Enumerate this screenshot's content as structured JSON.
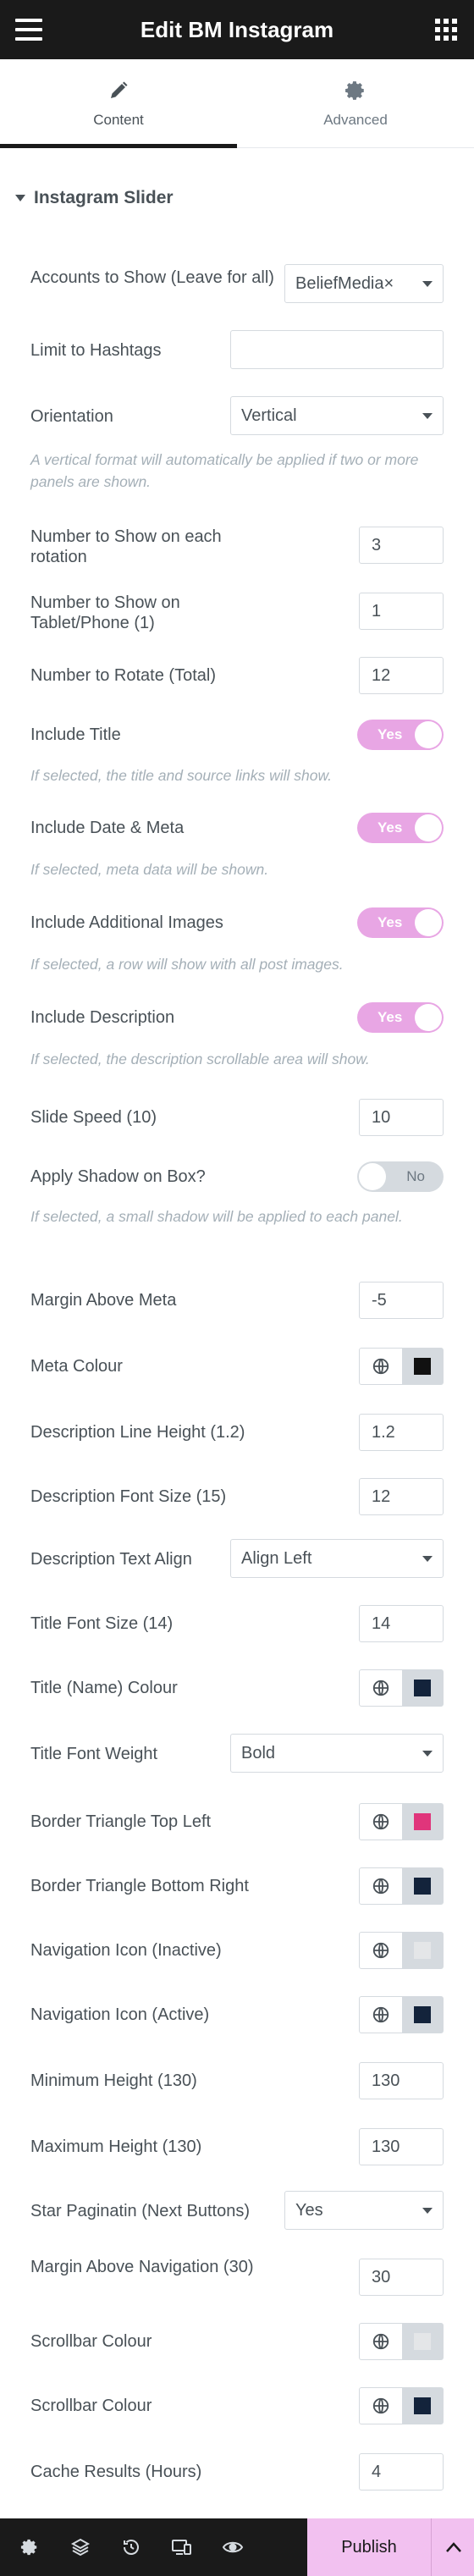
{
  "header": {
    "title": "Edit BM Instagram"
  },
  "tabs": {
    "content": "Content",
    "advanced": "Advanced"
  },
  "section": {
    "title": "Instagram Slider"
  },
  "fields": {
    "accounts": {
      "label": "Accounts to Show (Leave for all)",
      "value": "BeliefMedia×"
    },
    "hashtags": {
      "label": "Limit to Hashtags",
      "value": ""
    },
    "orientation": {
      "label": "Orientation",
      "value": "Vertical",
      "desc": "A vertical format will automatically be applied if two or more panels are shown."
    },
    "num_show": {
      "label": "Number to Show on each rotation",
      "value": "3"
    },
    "num_tablet": {
      "label": "Number to Show on Tablet/Phone (1)",
      "value": "1"
    },
    "num_rotate": {
      "label": "Number to Rotate (Total)",
      "value": "12"
    },
    "include_title": {
      "label": "Include Title",
      "state": "Yes",
      "desc": "If selected, the title and source links will show."
    },
    "include_date": {
      "label": "Include Date & Meta",
      "state": "Yes",
      "desc": "If selected, meta data will be shown."
    },
    "include_images": {
      "label": "Include Additional Images",
      "state": "Yes",
      "desc": "If selected, a row will show with all post images."
    },
    "include_desc": {
      "label": "Include Description",
      "state": "Yes",
      "desc": "If selected, the description scrollable area will show."
    },
    "slide_speed": {
      "label": "Slide Speed (10)",
      "value": "10"
    },
    "shadow": {
      "label": "Apply Shadow on Box?",
      "state": "No",
      "desc": "If selected, a small shadow will be applied to each panel."
    },
    "margin_meta": {
      "label": "Margin Above Meta",
      "value": "-5"
    },
    "meta_colour": {
      "label": "Meta Colour",
      "color": "#111111"
    },
    "desc_line_height": {
      "label": "Description Line Height (1.2)",
      "value": "1.2"
    },
    "desc_font_size": {
      "label": "Description Font Size (15)",
      "value": "12"
    },
    "desc_align": {
      "label": "Description Text Align",
      "value": "Align Left"
    },
    "title_font_size": {
      "label": "Title Font Size (14)",
      "value": "14"
    },
    "title_colour": {
      "label": "Title (Name) Colour",
      "color": "#13233b"
    },
    "title_weight": {
      "label": "Title Font Weight",
      "value": "Bold"
    },
    "border_top_left": {
      "label": "Border Triangle Top Left",
      "color": "#e0357b"
    },
    "border_bottom_right": {
      "label": "Border Triangle Bottom Right",
      "color": "#13233b"
    },
    "nav_inactive": {
      "label": "Navigation Icon (Inactive)",
      "color": "#d9dcdf"
    },
    "nav_active": {
      "label": "Navigation Icon (Active)",
      "color": "#13233b"
    },
    "min_height": {
      "label": "Minimum Height (130)",
      "value": "130"
    },
    "max_height": {
      "label": "Maximum Height (130)",
      "value": "130"
    },
    "star_pag": {
      "label": "Star Paginatin (Next Buttons)",
      "value": "Yes"
    },
    "margin_nav": {
      "label": "Margin Above Navigation (30)",
      "value": "30"
    },
    "scrollbar_1": {
      "label": "Scrollbar Colour",
      "color": "#d9dcdf"
    },
    "scrollbar_2": {
      "label": "Scrollbar Colour",
      "color": "#13233b"
    },
    "cache": {
      "label": "Cache Results (Hours)",
      "value": "4"
    }
  },
  "footer": {
    "publish": "Publish"
  },
  "colors": {
    "header_bg": "#1a1a1a",
    "toggle_on": "#e8a6e4",
    "publish_bg": "#f2c1f0"
  }
}
